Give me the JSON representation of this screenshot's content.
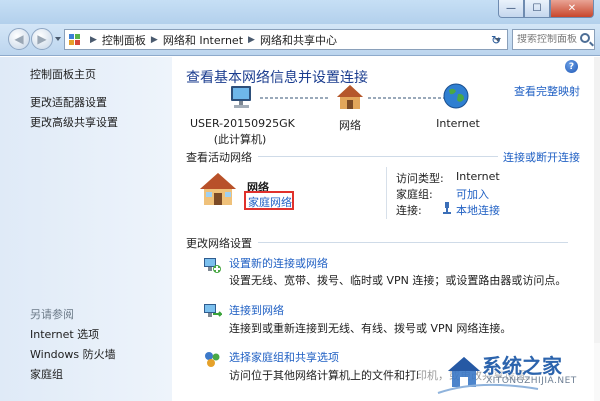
{
  "window": {
    "minimize_glyph": "—",
    "maximize_glyph": "☐",
    "close_glyph": "✕"
  },
  "navbar": {
    "back_glyph": "◀",
    "forward_glyph": "▶",
    "refresh_glyph": "↻",
    "breadcrumbs": [
      "控制面板",
      "网络和 Internet",
      "网络和共享中心"
    ],
    "search_placeholder": "搜索控制面板"
  },
  "sidebar": {
    "items": [
      {
        "label": "控制面板主页"
      },
      {
        "label": "更改适配器设置"
      },
      {
        "label": "更改高级共享设置"
      }
    ],
    "see_also_heading": "另请参阅",
    "see_also": [
      {
        "label": "Internet 选项"
      },
      {
        "label": "Windows 防火墙"
      },
      {
        "label": "家庭组"
      }
    ]
  },
  "main": {
    "help_glyph": "?",
    "title": "查看基本网络信息并设置连接",
    "full_map_link": "查看完整映射",
    "network_map": {
      "computer": {
        "name": "USER-20150925GK",
        "subtitle": "(此计算机)"
      },
      "network": {
        "name": "网络"
      },
      "internet": {
        "name": "Internet"
      }
    },
    "active_networks": {
      "heading": "查看活动网络",
      "connect_link": "连接或断开连接",
      "network_name": "网络",
      "network_type": "家庭网络",
      "access_type_label": "访问类型:",
      "access_type_value": "Internet",
      "homegroup_label": "家庭组:",
      "homegroup_value": "可加入",
      "connections_label": "连接:",
      "connections_value": "本地连接"
    },
    "change_settings": {
      "heading": "更改网络设置",
      "tasks": [
        {
          "title": "设置新的连接或网络",
          "desc": "设置无线、宽带、拨号、临时或 VPN 连接；或设置路由器或访问点。"
        },
        {
          "title": "连接到网络",
          "desc": "连接到或重新连接到无线、有线、拨号或 VPN 网络连接。"
        },
        {
          "title": "选择家庭组和共享选项",
          "desc": "访问位于其他网络计算机上的文件和打印机，或更改共享设置。"
        }
      ]
    }
  },
  "watermark": {
    "text": "系统之家",
    "url": "XITONGZHIJIA.NET"
  },
  "colors": {
    "link": "#2161c4",
    "title": "#1b3d8f",
    "highlight_box": "#e0312c",
    "sidebar_bg": "#dfeaf7"
  }
}
